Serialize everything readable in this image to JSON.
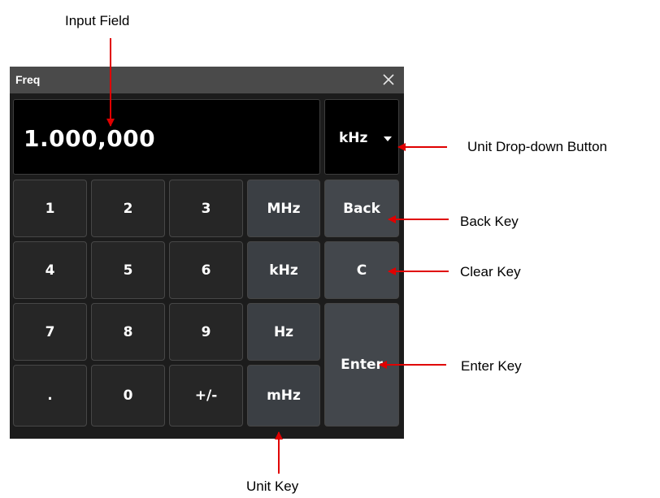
{
  "annotations": {
    "input_field": "Input Field",
    "unit_dropdown_button": "Unit Drop-down Button",
    "back_key": "Back Key",
    "clear_key": "Clear Key",
    "enter_key": "Enter Key",
    "unit_key": "Unit Key"
  },
  "dialog": {
    "title": "Freq",
    "close_icon": "close-icon",
    "input_value": "1.000,000",
    "unit_dropdown": {
      "label": "kHz",
      "icon": "caret-down-icon"
    }
  },
  "keypad": {
    "row1": [
      "1",
      "2",
      "3",
      "MHz",
      "Back"
    ],
    "row2": [
      "4",
      "5",
      "6",
      "kHz",
      "C"
    ],
    "row3": [
      "7",
      "8",
      "9",
      "Hz"
    ],
    "row4": [
      ".",
      "0",
      "+/-",
      "mHz"
    ],
    "enter": "Enter"
  },
  "colors": {
    "titlebar": "#4a4a4a",
    "panel": "#1c1c1c",
    "number_key": "#262626",
    "unit_key": "#3b3f44",
    "function_key": "#43474c",
    "arrow": "#e00000"
  }
}
